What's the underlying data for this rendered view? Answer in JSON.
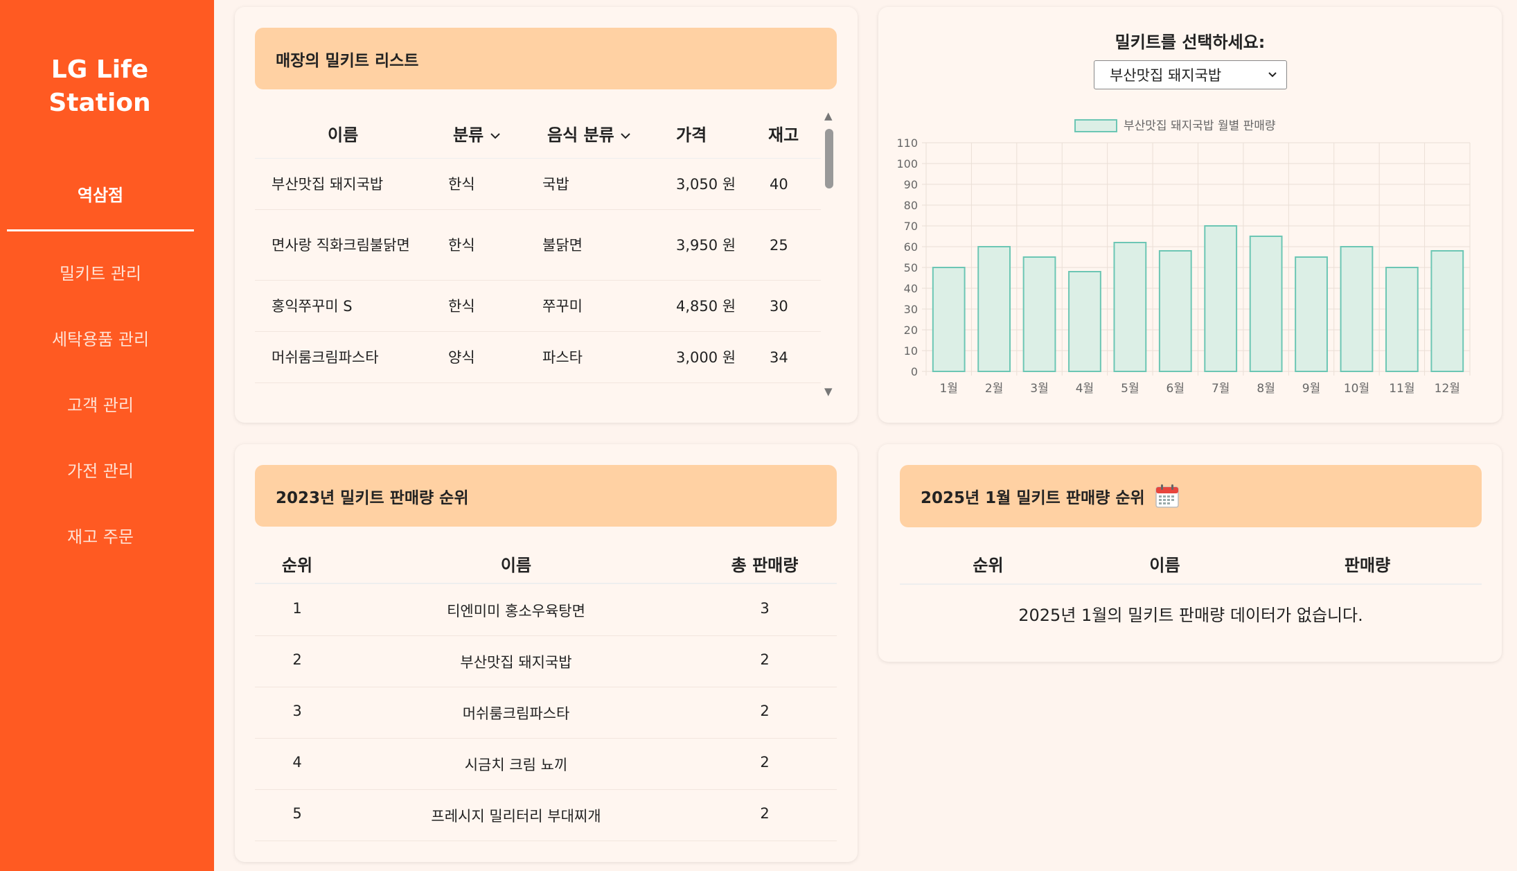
{
  "sidebar": {
    "brand_line1": "LG Life",
    "brand_line2": "Station",
    "store": "역삼점",
    "items": [
      {
        "label": "밀키트 관리"
      },
      {
        "label": "세탁용품 관리"
      },
      {
        "label": "고객 관리"
      },
      {
        "label": "가전 관리"
      },
      {
        "label": "재고 주문"
      }
    ]
  },
  "mealkit_list": {
    "title": "매장의 밀키트 리스트",
    "columns": {
      "name": "이름",
      "category": "분류",
      "food_category": "음식 분류",
      "price": "가격",
      "stock": "재고"
    },
    "sort_icon": "chevron-down-icon",
    "rows": [
      {
        "name": "부산맛집 돼지국밥",
        "category": "한식",
        "food": "국밥",
        "price": "3,050 원",
        "stock": "40"
      },
      {
        "name": "면사랑 직화크림불닭면",
        "category": "한식",
        "food": "불닭면",
        "price": "3,950 원",
        "stock": "25"
      },
      {
        "name": "홍익쭈꾸미 S",
        "category": "한식",
        "food": "쭈꾸미",
        "price": "4,850 원",
        "stock": "30"
      },
      {
        "name": "머쉬룸크림파스타",
        "category": "양식",
        "food": "파스타",
        "price": "3,000 원",
        "stock": "34"
      }
    ]
  },
  "chart_panel": {
    "prompt": "밀키트를 선택하세요:",
    "selected": "부산맛집 돼지국밥"
  },
  "chart_data": {
    "type": "bar",
    "legend": "부산맛집 돼지국밥 월별 판매량",
    "legend_position": "top",
    "categories": [
      "1월",
      "2월",
      "3월",
      "4월",
      "5월",
      "6월",
      "7월",
      "8월",
      "9월",
      "10월",
      "11월",
      "12월"
    ],
    "values": [
      50,
      60,
      55,
      48,
      62,
      58,
      70,
      65,
      55,
      60,
      50,
      58
    ],
    "ylim": [
      0,
      110
    ],
    "yticks": [
      0,
      10,
      20,
      30,
      40,
      50,
      60,
      70,
      80,
      90,
      100,
      110
    ],
    "grid": true,
    "bar_fill": "#dcefe6",
    "bar_stroke": "#6cc6b4"
  },
  "ranking_2023": {
    "title": "2023년 밀키트 판매량 순위",
    "columns": {
      "rank": "순위",
      "name": "이름",
      "total": "총 판매량"
    },
    "rows": [
      {
        "rank": "1",
        "name": "티엔미미 홍소우육탕면",
        "total": "3"
      },
      {
        "rank": "2",
        "name": "부산맛집 돼지국밥",
        "total": "2"
      },
      {
        "rank": "3",
        "name": "머쉬룸크림파스타",
        "total": "2"
      },
      {
        "rank": "4",
        "name": "시금치 크림 뇨끼",
        "total": "2"
      },
      {
        "rank": "5",
        "name": "프레시지 밀리터리 부대찌개",
        "total": "2"
      }
    ]
  },
  "ranking_2025": {
    "title": "2025년 1월 밀키트 판매량 순위",
    "icon": "calendar-icon",
    "columns": {
      "rank": "순위",
      "name": "이름",
      "sales": "판매량"
    },
    "empty_message": "2025년 1월의 밀키트 판매량 데이터가 없습니다."
  },
  "colors": {
    "sidebar": "#ff5a22",
    "card_header": "#ffd1a3",
    "background": "#fef4ee"
  }
}
